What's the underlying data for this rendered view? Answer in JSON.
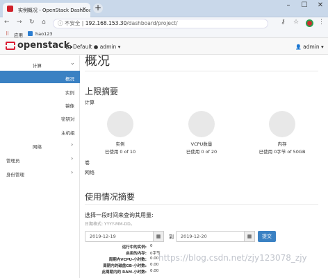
{
  "browser": {
    "tab_title": "实例概况 - OpenStack Dashboard",
    "close_glyph": "×",
    "new_tab_glyph": "+",
    "insecure_label": "不安全",
    "host": "192.168.153.30",
    "path": "/dashboard/project/",
    "bookmarks": [
      {
        "label": "应用"
      },
      {
        "label": "hao123"
      }
    ]
  },
  "header": {
    "logo_text": "openstack.",
    "project_label": "Default ● admin ▾",
    "user_label": "admin ▾"
  },
  "sidebar": {
    "items": [
      {
        "label": "计算"
      },
      {
        "label": "概况"
      },
      {
        "label": "实例"
      },
      {
        "label": "镜像"
      },
      {
        "label": "密钥对"
      },
      {
        "label": "主机组"
      },
      {
        "label": "网络"
      },
      {
        "label": "管理员"
      },
      {
        "label": "身份管理"
      }
    ]
  },
  "main": {
    "title": "概况",
    "limits_title": "上限摘要",
    "compute_label": "计算",
    "quotas": [
      {
        "name": "实例",
        "usage": "已使用 0 of 10",
        "fraction": 0
      },
      {
        "name": "VCPU数量",
        "usage": "已使用 0 of 20",
        "fraction": 0
      },
      {
        "name": "内存",
        "usage": "已使用 0字节 of 50GB",
        "fraction": 0
      }
    ],
    "volume_label": "卷",
    "network_label": "网络",
    "usage_title": "使用情况摘要",
    "period_prompt": "选择一段时间来查询其用量:",
    "date_hint": "日期格式: YYYY-MM-DD。",
    "start_date": "2019-12-19",
    "to_label": "到",
    "end_date": "2019-12-20",
    "submit_label": "提交",
    "summary": [
      {
        "label": "运行中的实例:",
        "value": "0"
      },
      {
        "label": "启用的内存:",
        "value": "0字节"
      },
      {
        "label": "周期内VCPU-小时数:",
        "value": "0.00"
      },
      {
        "label": "周期内的磁盘GB-小时数:",
        "value": "0.00"
      },
      {
        "label": "此周期内的 RAM-小时数:",
        "value": "0.00"
      }
    ],
    "watermark": "https://blog.csdn.net/zjy123078_zjy"
  }
}
